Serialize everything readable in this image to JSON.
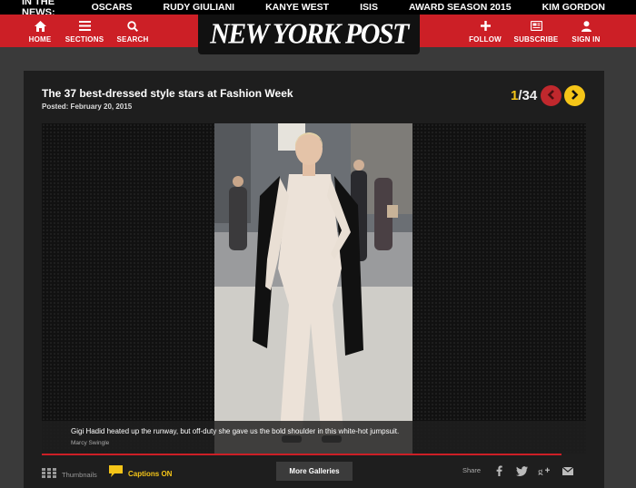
{
  "trending": {
    "label": "IN THE NEWS:",
    "items": [
      "OSCARS",
      "RUDY GIULIANI",
      "KANYE WEST",
      "ISIS",
      "AWARD SEASON 2015",
      "KIM GORDON"
    ]
  },
  "header": {
    "nav_left": [
      {
        "label": "HOME",
        "icon": "home-icon"
      },
      {
        "label": "SECTIONS",
        "icon": "menu-icon"
      },
      {
        "label": "SEARCH",
        "icon": "search-icon"
      }
    ],
    "logo": "NEW YORK POST",
    "nav_right": [
      {
        "label": "FOLLOW",
        "icon": "plus-icon"
      },
      {
        "label": "SUBSCRIBE",
        "icon": "newspaper-icon"
      },
      {
        "label": "SIGN IN",
        "icon": "user-icon"
      }
    ]
  },
  "gallery": {
    "title": "The 37 best-dressed style stars at Fashion Week",
    "posted": "Posted: February 20, 2015",
    "current": "1",
    "total": "/34",
    "caption": "Gigi Hadid heated up the runway, but off-duty she gave us the bold shoulder in this white-hot jumpsuit.",
    "credit": "Marcy Swingle"
  },
  "toolbar": {
    "thumbnails": "Thumbnails",
    "captions": "Captions ON",
    "more_galleries": "More Galleries",
    "share": "Share"
  },
  "colors": {
    "brand_red": "#cc1f26",
    "accent_yellow": "#f5c518",
    "panel_bg": "#1e1e1e"
  }
}
